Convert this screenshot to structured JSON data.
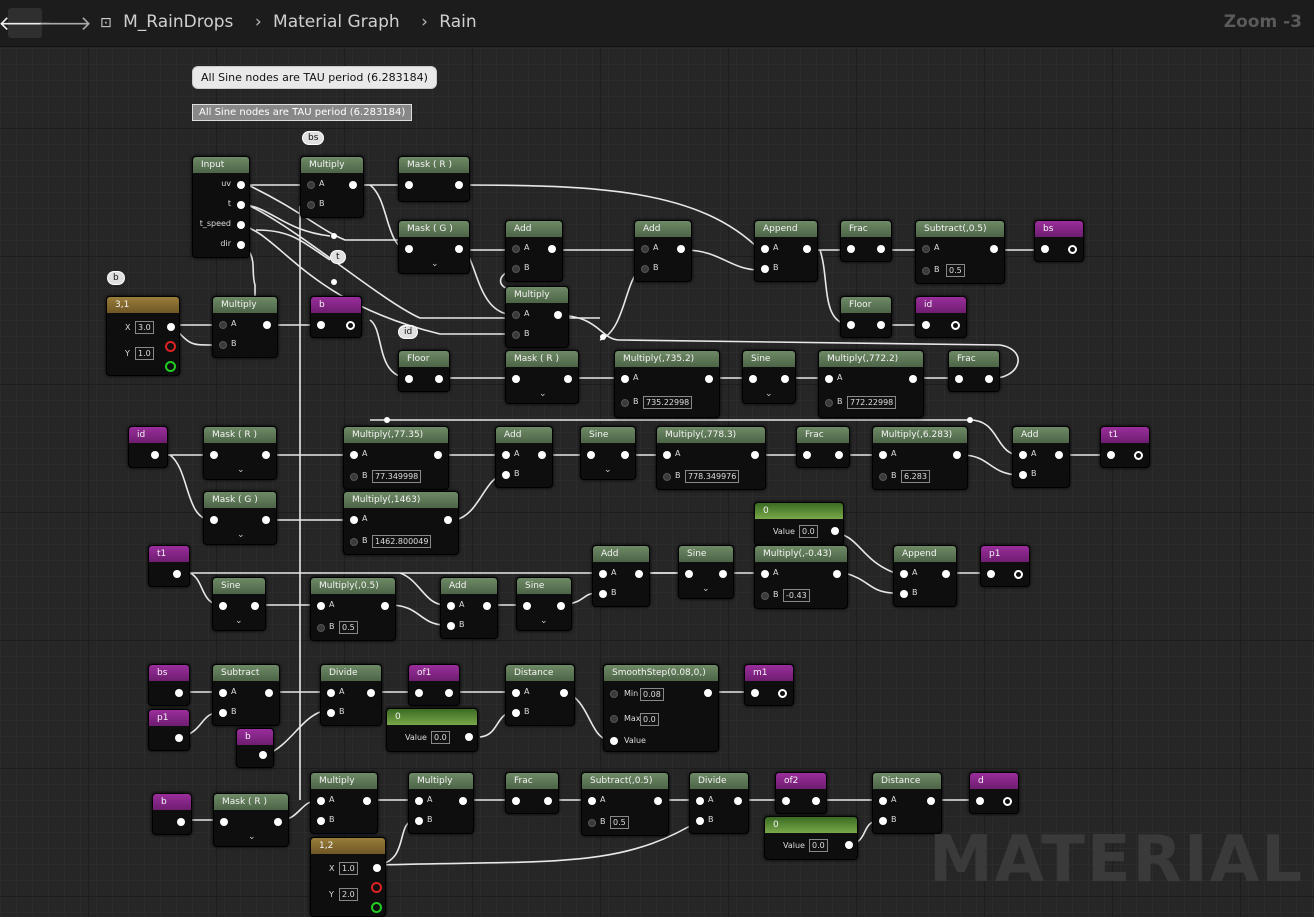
{
  "topbar": {
    "back_icon": "arrow-left-icon",
    "forward_icon": "arrow-right-icon",
    "crumbs": [
      "M_RainDrops",
      "Material Graph",
      "Rain"
    ],
    "zoom": "Zoom -3"
  },
  "comments": {
    "bubble_text": "All Sine nodes are TAU period (6.283184)",
    "box_text": "All Sine nodes are TAU period (6.283184)"
  },
  "watermark": "MATERIAL",
  "bubbles": {
    "bs": "bs",
    "b": "b",
    "t": "t",
    "id": "id"
  },
  "nodes": {
    "input": {
      "title": "Input",
      "pins": [
        "uv",
        "t",
        "t_speed",
        "dir"
      ]
    },
    "multiply_top": {
      "title": "Multiply",
      "a": "A",
      "b": "B"
    },
    "mask_r1": {
      "title": "Mask ( R )"
    },
    "mask_g1": {
      "title": "Mask ( G )"
    },
    "add1": {
      "title": "Add",
      "a": "A",
      "b": "B"
    },
    "add2": {
      "title": "Add",
      "a": "A",
      "b": "B"
    },
    "append1": {
      "title": "Append",
      "a": "A",
      "b": "B"
    },
    "frac1": {
      "title": "Frac"
    },
    "subtract05": {
      "title": "Subtract(,0.5)",
      "a": "A",
      "b": "B",
      "bval": "0.5"
    },
    "bs_out": {
      "title": "bs"
    },
    "floor1": {
      "title": "Floor"
    },
    "id_out": {
      "title": "id"
    },
    "multiply_mid": {
      "title": "Multiply",
      "a": "A",
      "b": "B"
    },
    "const31": {
      "title": "3,1",
      "x": "X",
      "y": "Y",
      "xval": "3.0",
      "yval": "1.0"
    },
    "multiply_b": {
      "title": "Multiply",
      "a": "A",
      "b": "B"
    },
    "b_out": {
      "title": "b"
    },
    "floor2": {
      "title": "Floor"
    },
    "mask_r2": {
      "title": "Mask ( R )"
    },
    "mul7352": {
      "title": "Multiply(,735.2)",
      "a": "A",
      "b": "B",
      "bval": "735.22998"
    },
    "sine1": {
      "title": "Sine"
    },
    "mul7722": {
      "title": "Multiply(,772.2)",
      "a": "A",
      "b": "B",
      "bval": "772.22998"
    },
    "frac2": {
      "title": "Frac"
    },
    "id_in": {
      "title": "id"
    },
    "mask_r3": {
      "title": "Mask ( R )"
    },
    "mask_g3": {
      "title": "Mask ( G )"
    },
    "mul7735": {
      "title": "Multiply(,77.35)",
      "a": "A",
      "b": "B",
      "bval": "77.349998"
    },
    "mul1463": {
      "title": "Multiply(,1463)",
      "a": "A",
      "b": "B",
      "bval": "1462.800049"
    },
    "add3": {
      "title": "Add",
      "a": "A",
      "b": "B"
    },
    "sine2": {
      "title": "Sine"
    },
    "mul7783": {
      "title": "Multiply(,778.3)",
      "a": "A",
      "b": "B",
      "bval": "778.349976"
    },
    "frac3": {
      "title": "Frac"
    },
    "mul6283": {
      "title": "Multiply(,6.283)",
      "a": "A",
      "b": "B",
      "bval": "6.283"
    },
    "add4": {
      "title": "Add",
      "a": "A",
      "b": "B"
    },
    "t1_out": {
      "title": "t1"
    },
    "const0a": {
      "title": "0",
      "label": "Value",
      "val": "0.0"
    },
    "t1_in": {
      "title": "t1"
    },
    "sine3": {
      "title": "Sine"
    },
    "mul05": {
      "title": "Multiply(,0.5)",
      "a": "A",
      "b": "B",
      "bval": "0.5"
    },
    "add5": {
      "title": "Add",
      "a": "A",
      "b": "B"
    },
    "sine4": {
      "title": "Sine"
    },
    "add6": {
      "title": "Add",
      "a": "A",
      "b": "B"
    },
    "sine5": {
      "title": "Sine"
    },
    "mulneg043": {
      "title": "Multiply(,-0.43)",
      "a": "A",
      "b": "B",
      "bval": "-0.43"
    },
    "append2": {
      "title": "Append",
      "a": "A",
      "b": "B"
    },
    "p1_out": {
      "title": "p1"
    },
    "bs_in": {
      "title": "bs"
    },
    "p1_in": {
      "title": "p1"
    },
    "subtract": {
      "title": "Subtract",
      "a": "A",
      "b": "B"
    },
    "b_in1": {
      "title": "b"
    },
    "divide1": {
      "title": "Divide",
      "a": "A",
      "b": "B"
    },
    "of1": {
      "title": "of1"
    },
    "const0b": {
      "title": "0",
      "label": "Value",
      "val": "0.0"
    },
    "distance1": {
      "title": "Distance",
      "a": "A",
      "b": "B"
    },
    "smoothstep": {
      "title": "SmoothStep(0.08,0,)",
      "min": "Min",
      "max": "Max",
      "value": "Value",
      "minval": "0.08",
      "maxval": "0.0"
    },
    "m1": {
      "title": "m1"
    },
    "b_in2": {
      "title": "b"
    },
    "mask_r4": {
      "title": "Mask ( R )"
    },
    "multiply_bot": {
      "title": "Multiply",
      "a": "A",
      "b": "B"
    },
    "multiply_bot2": {
      "title": "Multiply",
      "a": "A",
      "b": "B"
    },
    "frac4": {
      "title": "Frac"
    },
    "subtract05b": {
      "title": "Subtract(,0.5)",
      "a": "A",
      "b": "B",
      "bval": "0.5"
    },
    "divide2": {
      "title": "Divide",
      "a": "A",
      "b": "B"
    },
    "of2": {
      "title": "of2"
    },
    "const0c": {
      "title": "0",
      "label": "Value",
      "val": "0.0"
    },
    "distance2": {
      "title": "Distance",
      "a": "A",
      "b": "B"
    },
    "d_out": {
      "title": "d"
    },
    "const12": {
      "title": "1,2",
      "x": "X",
      "y": "Y",
      "xval": "1.0",
      "yval": "2.0"
    }
  }
}
